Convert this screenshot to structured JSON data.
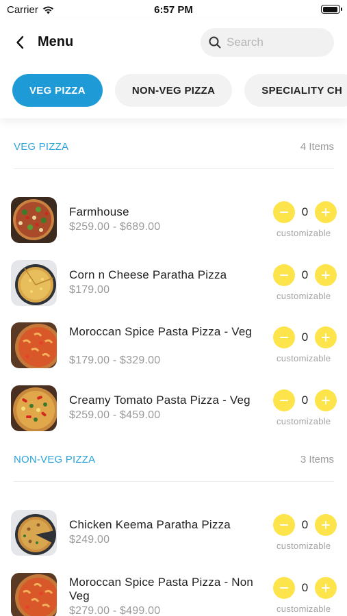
{
  "status_bar": {
    "carrier": "Carrier",
    "time": "6:57 PM"
  },
  "header": {
    "title": "Menu",
    "search_placeholder": "Search"
  },
  "tabs": [
    {
      "label": "VEG PIZZA",
      "active": true
    },
    {
      "label": "NON-VEG PIZZA",
      "active": false
    },
    {
      "label": "SPECIALITY CH",
      "active": false
    }
  ],
  "sections": [
    {
      "title": "VEG PIZZA",
      "count": "4 Items",
      "items": [
        {
          "name": "Farmhouse",
          "price": "$259.00 - $689.00",
          "qty": "0",
          "note": "customizable",
          "image": "farmhouse-pizza"
        },
        {
          "name": "Corn n Cheese Paratha Pizza",
          "price": "$179.00",
          "qty": "0",
          "note": "customizable",
          "image": "paratha-pizza"
        },
        {
          "name": "Moroccan Spice Pasta Pizza - Veg",
          "price": "$179.00 - $329.00",
          "qty": "0",
          "note": "customizable",
          "image": "moroccan-pizza"
        },
        {
          "name": "Creamy Tomato Pasta Pizza - Veg",
          "price": "$259.00 - $459.00",
          "qty": "0",
          "note": "customizable",
          "image": "creamy-tomato-pizza"
        }
      ]
    },
    {
      "title": "NON-VEG PIZZA",
      "count": "3 Items",
      "items": [
        {
          "name": "Chicken Keema Paratha Pizza",
          "price": "$249.00",
          "qty": "0",
          "note": "customizable",
          "image": "keema-paratha-pizza"
        },
        {
          "name": "Moroccan Spice Pasta Pizza - Non Veg",
          "price": "$279.00 - $499.00",
          "qty": "0",
          "note": "customizable",
          "image": "moroccan-pizza"
        }
      ]
    }
  ],
  "colors": {
    "accent": "#1e9bd7",
    "section_title": "#2aa3d8",
    "qty_button": "#fde44a"
  }
}
